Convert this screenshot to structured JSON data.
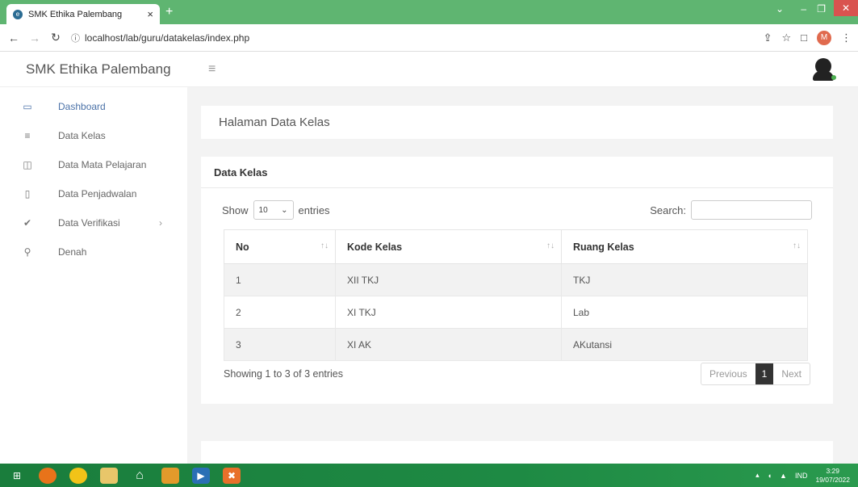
{
  "browser": {
    "tab_title": "SMK Ethika Palembang",
    "tab_close": "×",
    "new_tab": "+",
    "url": "localhost/lab/guru/datakelas/index.php",
    "profile_initial": "M"
  },
  "app": {
    "brand": "SMK Ethika Palembang"
  },
  "sidebar": {
    "items": [
      {
        "label": "Dashboard",
        "icon": "laptop-icon"
      },
      {
        "label": "Data Kelas",
        "icon": "list-icon"
      },
      {
        "label": "Data Mata Pelajaran",
        "icon": "columns-icon"
      },
      {
        "label": "Data Penjadwalan",
        "icon": "file-icon"
      },
      {
        "label": "Data Verifikasi",
        "icon": "check-icon"
      },
      {
        "label": "Denah",
        "icon": "map-pin-icon"
      }
    ]
  },
  "page": {
    "title": "Halaman Data Kelas"
  },
  "card": {
    "title": "Data Kelas",
    "show_label": "Show",
    "entries_value": "10",
    "entries_label": "entries",
    "search_label": "Search:",
    "search_value": "",
    "info": "Showing 1 to 3 of 3 entries",
    "prev_label": "Previous",
    "page_current": "1",
    "next_label": "Next"
  },
  "table": {
    "columns": [
      "No",
      "Kode Kelas",
      "Ruang Kelas"
    ],
    "rows": [
      [
        "1",
        "XII TKJ",
        "TKJ"
      ],
      [
        "2",
        "XI TKJ",
        "Lab"
      ],
      [
        "3",
        "XI AK",
        "AKutansi"
      ]
    ]
  },
  "taskbar": {
    "lang": "IND",
    "time": "3:29",
    "date": "19/07/2022"
  }
}
